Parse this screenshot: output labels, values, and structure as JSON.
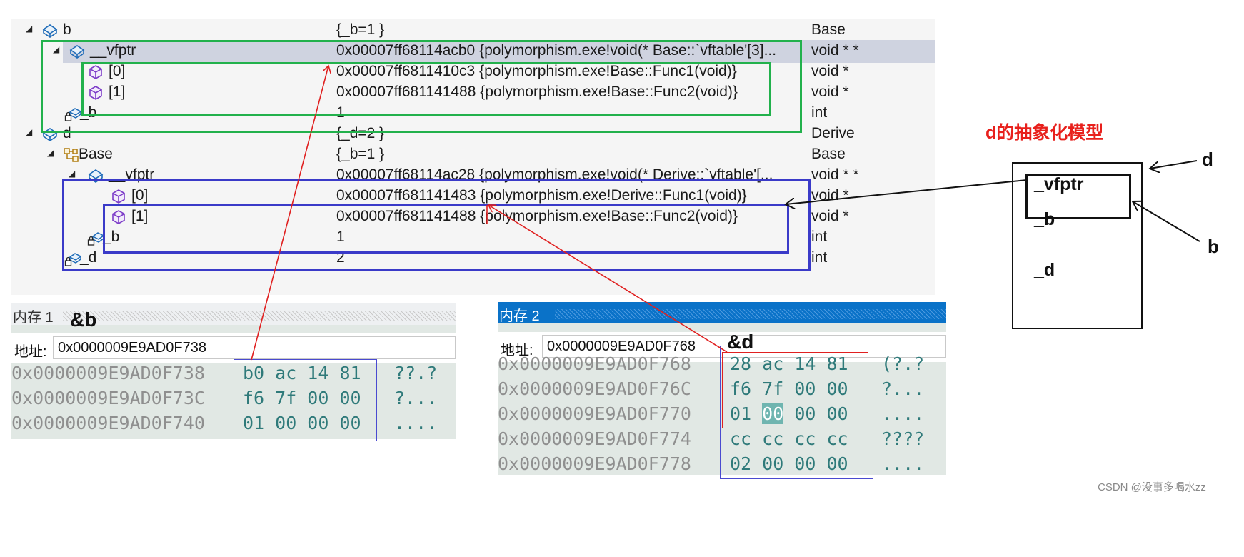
{
  "watch": {
    "rows": [
      {
        "name": "b",
        "value": "{_b=1 }",
        "type": "Base",
        "icon": "struct-icon",
        "expander": "collapse-arrow-icon"
      },
      {
        "name": "__vfptr",
        "value": "0x00007ff68114acb0 {polymorphism.exe!void(* Base::`vftable'[3]...",
        "type": "void * *",
        "icon": "struct-icon",
        "expander": "collapse-arrow-icon"
      },
      {
        "name": "[0]",
        "value": "0x00007ff6811410c3 {polymorphism.exe!Base::Func1(void)}",
        "type": "void *",
        "icon": "method-icon"
      },
      {
        "name": "[1]",
        "value": "0x00007ff681141488 {polymorphism.exe!Base::Func2(void)}",
        "type": "void *",
        "icon": "method-icon"
      },
      {
        "name": "_b",
        "value": "1",
        "type": "int",
        "icon": "field-locked-icon"
      },
      {
        "name": "d",
        "value": "{_d=2 }",
        "type": "Derive",
        "icon": "struct-icon",
        "expander": "collapse-arrow-icon"
      },
      {
        "name": "Base",
        "value": "{_b=1 }",
        "type": "Base",
        "icon": "base-class-icon",
        "expander": "collapse-arrow-icon"
      },
      {
        "name": "__vfptr",
        "value": "0x00007ff68114ac28 {polymorphism.exe!void(* Derive::`vftable'[...",
        "type": "void * *",
        "icon": "struct-icon",
        "expander": "collapse-arrow-icon"
      },
      {
        "name": "[0]",
        "value": "0x00007ff681141483 {polymorphism.exe!Derive::Func1(void)}",
        "type": "void *",
        "icon": "method-icon"
      },
      {
        "name": "[1]",
        "value": "0x00007ff681141488 {polymorphism.exe!Base::Func2(void)}",
        "type": "void *",
        "icon": "method-icon"
      },
      {
        "name": "_b",
        "value": "1",
        "type": "int",
        "icon": "field-locked-icon"
      },
      {
        "name": "_d",
        "value": "2",
        "type": "int",
        "icon": "field-locked-icon"
      }
    ]
  },
  "memory1": {
    "title": "内存 1",
    "address_label": "地址:",
    "address_value": "0x0000009E9AD0F738",
    "lines": [
      {
        "addr": "0x0000009E9AD0F738",
        "bytes": "b0 ac 14 81",
        "chars": "??.?"
      },
      {
        "addr": "0x0000009E9AD0F73C",
        "bytes": "f6 7f 00 00",
        "chars": "?..."
      },
      {
        "addr": "0x0000009E9AD0F740",
        "bytes": "01 00 00 00",
        "chars": "...."
      }
    ]
  },
  "memory2": {
    "title": "内存 2",
    "address_label": "地址:",
    "address_value": "0x0000009E9AD0F768",
    "lines": [
      {
        "addr": "0x0000009E9AD0F768",
        "bytes": "28 ac 14 81",
        "chars": "(?.?"
      },
      {
        "addr": "0x0000009E9AD0F76C",
        "bytes": "f6 7f 00 00",
        "chars": "?..."
      },
      {
        "addr": "0x0000009E9AD0F770",
        "bytes_pre": "01 ",
        "bytes_hl": "00",
        "bytes_post": " 00 00",
        "chars": "...."
      },
      {
        "addr": "0x0000009E9AD0F774",
        "bytes": "cc cc cc cc",
        "chars": "????"
      },
      {
        "addr": "0x0000009E9AD0F778",
        "bytes": "02 00 00 00",
        "chars": "...."
      }
    ]
  },
  "annotations": {
    "ref_b": "&b",
    "ref_d": "&d",
    "model_title": "d的抽象化模型",
    "model_vfptr": "_vfptr",
    "model_b": "_b",
    "model_d": "_d",
    "label_d": "d",
    "label_b": "b"
  },
  "colors": {
    "green_box": "#22b14c",
    "blue_box": "#3a3ac8",
    "red_arrow": "#e02020",
    "title_red": "#e8201c",
    "memory_blue_header": "#0a72c8"
  },
  "watermark": "CSDN @没事多喝水zz"
}
